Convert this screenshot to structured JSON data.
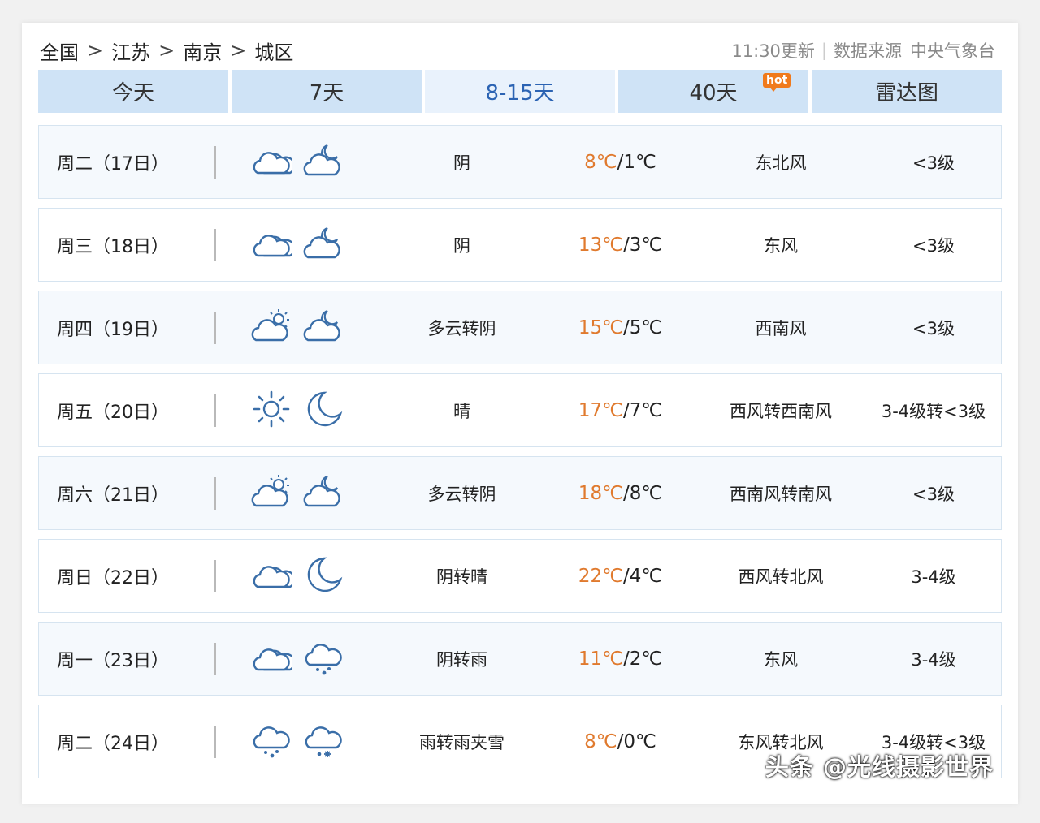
{
  "breadcrumb": [
    "全国",
    "江苏",
    "南京",
    "城区"
  ],
  "breadcrumb_sep": ">",
  "update_time": "11:30更新",
  "source_label": "数据来源",
  "source_name": "中央气象台",
  "tabs": [
    {
      "label": "今天",
      "active": false
    },
    {
      "label": "7天",
      "active": false
    },
    {
      "label": "8-15天",
      "active": true
    },
    {
      "label": "40天",
      "active": false,
      "badge": "hot"
    },
    {
      "label": "雷达图",
      "active": false
    }
  ],
  "rows": [
    {
      "day": "周二（17日）",
      "icon_day": "cloudy-icon",
      "icon_night": "cloudy-night-icon",
      "weather": "阴",
      "high": "8℃",
      "low": "1℃",
      "wind": "东北风",
      "level": "<3级"
    },
    {
      "day": "周三（18日）",
      "icon_day": "cloudy-icon",
      "icon_night": "cloudy-night-icon",
      "weather": "阴",
      "high": "13℃",
      "low": "3℃",
      "wind": "东风",
      "level": "<3级"
    },
    {
      "day": "周四（19日）",
      "icon_day": "partly-cloudy-icon",
      "icon_night": "cloudy-night-icon",
      "weather": "多云转阴",
      "high": "15℃",
      "low": "5℃",
      "wind": "西南风",
      "level": "<3级"
    },
    {
      "day": "周五（20日）",
      "icon_day": "sun-icon",
      "icon_night": "moon-icon",
      "weather": "晴",
      "high": "17℃",
      "low": "7℃",
      "wind": "西风转西南风",
      "level": "3-4级转<3级"
    },
    {
      "day": "周六（21日）",
      "icon_day": "partly-cloudy-icon",
      "icon_night": "cloudy-night-icon",
      "weather": "多云转阴",
      "high": "18℃",
      "low": "8℃",
      "wind": "西南风转南风",
      "level": "<3级"
    },
    {
      "day": "周日（22日）",
      "icon_day": "cloudy-icon",
      "icon_night": "moon-icon",
      "weather": "阴转晴",
      "high": "22℃",
      "low": "4℃",
      "wind": "西风转北风",
      "level": "3-4级"
    },
    {
      "day": "周一（23日）",
      "icon_day": "cloudy-icon",
      "icon_night": "rain-icon",
      "weather": "阴转雨",
      "high": "11℃",
      "low": "2℃",
      "wind": "东风",
      "level": "3-4级"
    },
    {
      "day": "周二（24日）",
      "icon_day": "rain-icon",
      "icon_night": "sleet-icon",
      "weather": "雨转雨夹雪",
      "high": "8℃",
      "low": "0℃",
      "wind": "东风转北风",
      "level": "3-4级转<3级"
    }
  ],
  "temp_sep": "/",
  "watermark": "头条 @光线摄影世界",
  "colors": {
    "tab_bg": "#cfe3f6",
    "tab_active_text": "#2b63b3",
    "high_temp": "#e07a2e",
    "icon": "#3a6ea8",
    "hot_badge": "#f07a1c"
  }
}
